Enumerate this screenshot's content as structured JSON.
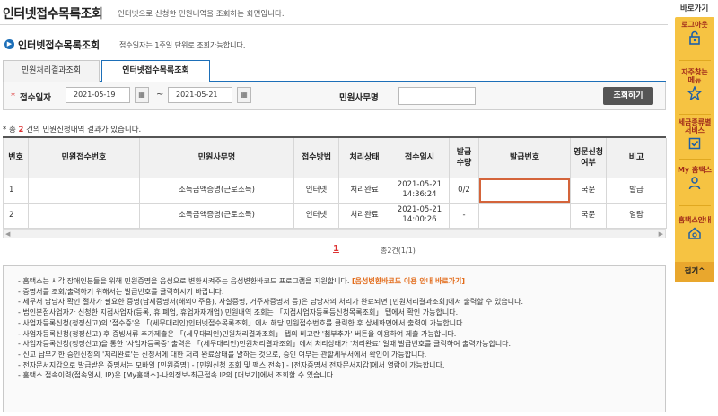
{
  "header": {
    "title": "인터넷접수목록조회",
    "subtitle": "인터넷으로 신청한 민원내역을 조회하는 화면입니다."
  },
  "section": {
    "title": "인터넷접수목록조회",
    "note": "접수일자는 1주일 단위로 조회가능합니다."
  },
  "tabs": [
    {
      "label": "민원처리결과조회",
      "active": false
    },
    {
      "label": "인터넷접수목록조회",
      "active": true
    }
  ],
  "search": {
    "required_mark": "*",
    "date_label": "접수일자",
    "date_from": "2021-05-19",
    "date_to": "2021-05-21",
    "tilde": "~",
    "office_label": "민원사무명",
    "office_value": "",
    "button_label": "조회하기"
  },
  "result_count": {
    "prefix": "총",
    "count": "2",
    "suffix": "건의 민원신청내역 결과가 있습니다."
  },
  "table": {
    "headers": [
      "번호",
      "민원접수번호",
      "민원사무명",
      "접수방법",
      "처리상태",
      "접수일시",
      "발급\n수량",
      "발급번호",
      "영문신청\n여부",
      "비고"
    ],
    "rows": [
      {
        "no": "1",
        "receipt_no": "",
        "office": "소득금액증명(근로소득)",
        "method": "인터넷",
        "status": "처리완료",
        "date": "2021-05-21",
        "time": "14:36:24",
        "qty": "0/2",
        "issue_no": "",
        "english": "국문",
        "note": "발급"
      },
      {
        "no": "2",
        "receipt_no": "",
        "office": "소득금액증명(근로소득)",
        "method": "인터넷",
        "status": "처리완료",
        "date": "2021-05-21",
        "time": "14:00:26",
        "qty": "-",
        "issue_no": "",
        "english": "국문",
        "note": "열람"
      }
    ]
  },
  "pager": {
    "current": "1",
    "total": "총2건(1/1)"
  },
  "notice": {
    "line1_text": "- 홈택스는 시각 장애인분들을 위해 민원증명을 음성으로 변환시켜주는 음성변환바코드 프로그램을 지원합니다.",
    "line1_link": "[음성변환바코드 이용 안내 바로가기]",
    "lines": [
      "- 증명서를 조회/출력하기 위해서는 발급번호를 클릭하시기 바랍니다.",
      "- 세무서 담당자 확인 절차가 필요한 증명(납세증명서(해외이주용), 사실증명, 거주자증명서 등)은 담당자의 처리가 완료되면 [민원처리결과조회]에서 출력할 수 있습니다.",
      "- 법인본점사업자가 신청한 지점사업자(등록, 휴 폐업, 휴업자재개업) 민원내역 조회는 「지점사업자등록등신청목록조회」 탭에서 확인 가능합니다.",
      "- 사업자등록신청(정정신고)의 '접수증'은 「(세무대리인)인터넷접수목록조회」에서 해당 민원접수번호를 클릭한 후 상세화면에서 출력이 가능합니다.",
      "- 사업자등록신청(정정신고) 후 증빙서류 추가제출은 「(세무대리인)민원처리결과조회」 탭의 비고란 '첨부추가' 버튼을 이용하여 제출 가능합니다.",
      "- 사업자등록신청(정정신고)을 통한 '사업자등록증' 출력은 「(세무대리인)민원처리결과조회」에서 처리상태가 '처리완료' 일때 발급번호를 클릭하여 출력가능합니다.",
      "- 신고 납부기한 승인신청의 '처리완료'는 신청서에 대한 처리 완료상태를 말하는 것으로, 승인 여부는 관할세무서에서 확인이 가능합니다.",
      "- 전자문서지갑으로 발급받은 증명서는 모바일 [민원증명] - [민원신청 조회 및 팩스 전송] - [전자증명서 전자문서지갑]에서 열람이 가능합니다.",
      "- 홈택스 접속이력(접속일시, IP)은 [My홈택스]-나의정보-최근접속 IP의 [더보기]에서 조회할 수 있습니다."
    ]
  },
  "quick_menu": {
    "title": "바로가기",
    "items": [
      {
        "label": "로그아웃",
        "icon": "logout-lock-icon"
      },
      {
        "label": "자주찾는 메뉴",
        "icon": "star-icon"
      },
      {
        "label": "세금종류별 서비스",
        "icon": "checkbox-icon"
      },
      {
        "label": "My 홈택스",
        "icon": "person-icon"
      },
      {
        "label": "홈택스안내",
        "icon": "home-info-icon"
      }
    ],
    "fold_label": "접기^"
  },
  "colors": {
    "accent_blue": "#1d6fb8",
    "quick_menu_bg": "#f6c342",
    "highlight_orange": "#d4643a",
    "link_orange": "#e26b1a",
    "count_red": "#dd3333"
  }
}
